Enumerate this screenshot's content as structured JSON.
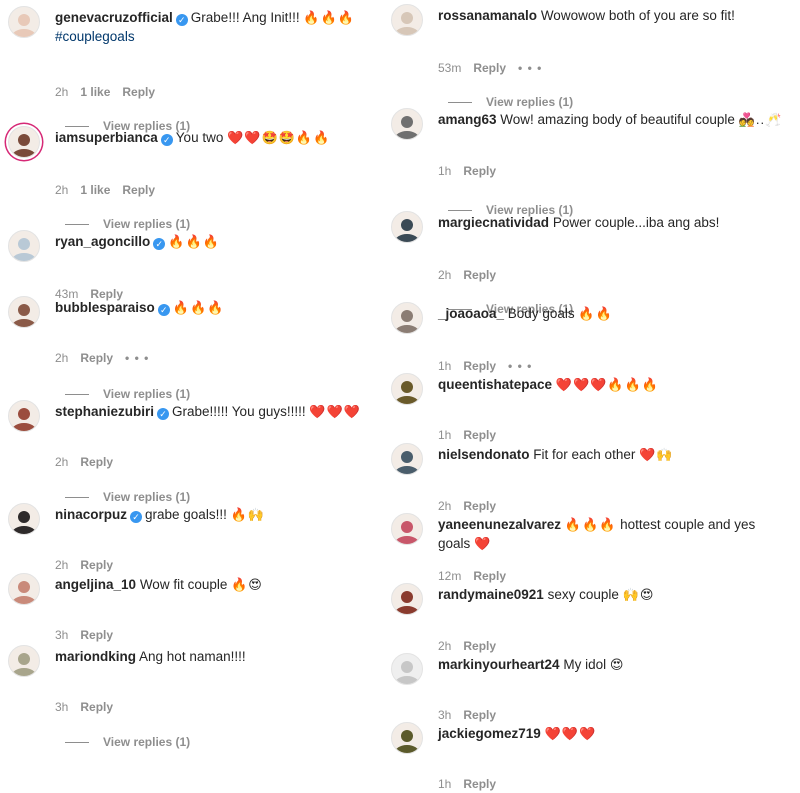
{
  "labels": {
    "reply": "Reply",
    "view_replies": "View replies (1)"
  },
  "left": [
    {
      "user": "genevacruzofficial",
      "verified": true,
      "text": "Grabe!!! Ang Init!!!",
      "emoji": "🔥🔥🔥",
      "hashtag": "#couplegoals",
      "time": "2h",
      "likes": "1 like",
      "replies": true,
      "avatar": "#e8c9b8"
    },
    {
      "user": "iamsuperbianca",
      "verified": true,
      "text": "You two",
      "emoji": "❤️❤️🤩🤩🔥🔥",
      "time": "2h",
      "likes": "1 like",
      "replies": true,
      "avatar": "#7a4a3a",
      "ring": true
    },
    {
      "user": "ryan_agoncillo",
      "verified": true,
      "text": "",
      "emoji": "🔥🔥🔥",
      "time": "43m",
      "avatar": "#b9c9d6"
    },
    {
      "user": "bubblesparaiso",
      "verified": true,
      "text": "",
      "emoji": "🔥🔥🔥",
      "time": "2h",
      "more": "• • •",
      "replies": true,
      "avatar": "#8a5a48"
    },
    {
      "user": "stephaniezubiri",
      "verified": true,
      "text": "Grabe!!!!! You guys!!!!!",
      "emoji": "❤️❤️❤️",
      "time": "2h",
      "replies": true,
      "avatar": "#9b4d3e"
    },
    {
      "user": "ninacorpuz",
      "verified": true,
      "text": "grabe goals!!!",
      "emoji": "🔥🙌",
      "time": "2h",
      "avatar": "#2e2a2a"
    },
    {
      "user": "angeljina_10",
      "verified": false,
      "text": "Wow fit couple",
      "emoji": "🔥😍",
      "time": "3h",
      "avatar": "#c98a7a"
    },
    {
      "user": "mariondking",
      "verified": false,
      "text": "Ang hot naman!!!!",
      "emoji": "",
      "time": "3h",
      "replies": true,
      "avatar": "#a8a58c"
    }
  ],
  "right": [
    {
      "user": "rossanamanalo",
      "verified": false,
      "text": "Wowowow both of you are so fit!",
      "emoji": "",
      "time": "53m",
      "more": "• • •",
      "replies": true,
      "avatar": "#d7c7b8"
    },
    {
      "user": "amang63",
      "verified": false,
      "text": "Wow! amazing body of beautiful couple",
      "emoji": "💑..🥂",
      "time": "1h",
      "replies": true,
      "avatar": "#6f6f6f"
    },
    {
      "user": "margiecnatividad",
      "verified": false,
      "text": "Power couple...iba ang abs!",
      "emoji": "",
      "time": "2h",
      "replies": true,
      "avatar": "#3b4a55"
    },
    {
      "user": "_joaoaoa_",
      "verified": false,
      "text": "Body goals",
      "emoji": "🔥🔥",
      "time": "1h",
      "more": "• • •",
      "avatar": "#8b7d74"
    },
    {
      "user": "queentishatepace",
      "verified": false,
      "text": "",
      "emoji": "❤️❤️❤️🔥🔥🔥",
      "time": "1h",
      "avatar": "#6a5a2a"
    },
    {
      "user": "nielsendonato",
      "verified": false,
      "text": "Fit for each other",
      "emoji": "❤️🙌",
      "time": "2h",
      "avatar": "#4a5d6b"
    },
    {
      "user": "yaneenunezalvarez",
      "verified": false,
      "text": "hottest couple and yes goals",
      "emoji_before": "🔥🔥🔥",
      "emoji": "❤️",
      "time": "12m",
      "avatar": "#c8576a"
    },
    {
      "user": "randymaine0921",
      "verified": false,
      "text": "sexy couple",
      "emoji": "🙌😍",
      "time": "2h",
      "avatar": "#8a3b2e"
    },
    {
      "user": "markinyourheart24",
      "verified": false,
      "text": "My idol",
      "emoji": "😍",
      "time": "3h",
      "avatar": "#dcdcdc",
      "blank": true
    },
    {
      "user": "jackiegomez719",
      "verified": false,
      "text": "",
      "emoji": "❤️❤️❤️",
      "time": "1h",
      "avatar": "#5b5a2b"
    }
  ]
}
